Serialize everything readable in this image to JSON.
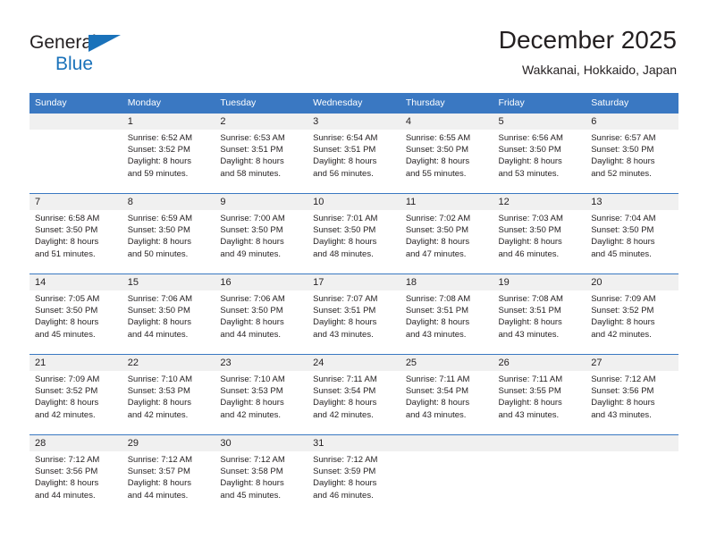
{
  "brand": {
    "name_top": "General",
    "name_bottom": "Blue",
    "triangle_color": "#1a72ba",
    "text_color": "#231f20"
  },
  "header": {
    "title": "December 2025",
    "subtitle": "Wakkanai, Hokkaido, Japan"
  },
  "theme": {
    "header_bg": "#3a78c2",
    "header_text": "#ffffff",
    "daynum_bg": "#f0f0f0",
    "cell_bg": "#ffffff",
    "body_text": "#231f20"
  },
  "calendar": {
    "weekday_headers": [
      "Sunday",
      "Monday",
      "Tuesday",
      "Wednesday",
      "Thursday",
      "Friday",
      "Saturday"
    ],
    "weeks": [
      [
        {
          "day": "",
          "lines": []
        },
        {
          "day": "1",
          "lines": [
            "Sunrise: 6:52 AM",
            "Sunset: 3:52 PM",
            "Daylight: 8 hours",
            "and 59 minutes."
          ]
        },
        {
          "day": "2",
          "lines": [
            "Sunrise: 6:53 AM",
            "Sunset: 3:51 PM",
            "Daylight: 8 hours",
            "and 58 minutes."
          ]
        },
        {
          "day": "3",
          "lines": [
            "Sunrise: 6:54 AM",
            "Sunset: 3:51 PM",
            "Daylight: 8 hours",
            "and 56 minutes."
          ]
        },
        {
          "day": "4",
          "lines": [
            "Sunrise: 6:55 AM",
            "Sunset: 3:50 PM",
            "Daylight: 8 hours",
            "and 55 minutes."
          ]
        },
        {
          "day": "5",
          "lines": [
            "Sunrise: 6:56 AM",
            "Sunset: 3:50 PM",
            "Daylight: 8 hours",
            "and 53 minutes."
          ]
        },
        {
          "day": "6",
          "lines": [
            "Sunrise: 6:57 AM",
            "Sunset: 3:50 PM",
            "Daylight: 8 hours",
            "and 52 minutes."
          ]
        }
      ],
      [
        {
          "day": "7",
          "lines": [
            "Sunrise: 6:58 AM",
            "Sunset: 3:50 PM",
            "Daylight: 8 hours",
            "and 51 minutes."
          ]
        },
        {
          "day": "8",
          "lines": [
            "Sunrise: 6:59 AM",
            "Sunset: 3:50 PM",
            "Daylight: 8 hours",
            "and 50 minutes."
          ]
        },
        {
          "day": "9",
          "lines": [
            "Sunrise: 7:00 AM",
            "Sunset: 3:50 PM",
            "Daylight: 8 hours",
            "and 49 minutes."
          ]
        },
        {
          "day": "10",
          "lines": [
            "Sunrise: 7:01 AM",
            "Sunset: 3:50 PM",
            "Daylight: 8 hours",
            "and 48 minutes."
          ]
        },
        {
          "day": "11",
          "lines": [
            "Sunrise: 7:02 AM",
            "Sunset: 3:50 PM",
            "Daylight: 8 hours",
            "and 47 minutes."
          ]
        },
        {
          "day": "12",
          "lines": [
            "Sunrise: 7:03 AM",
            "Sunset: 3:50 PM",
            "Daylight: 8 hours",
            "and 46 minutes."
          ]
        },
        {
          "day": "13",
          "lines": [
            "Sunrise: 7:04 AM",
            "Sunset: 3:50 PM",
            "Daylight: 8 hours",
            "and 45 minutes."
          ]
        }
      ],
      [
        {
          "day": "14",
          "lines": [
            "Sunrise: 7:05 AM",
            "Sunset: 3:50 PM",
            "Daylight: 8 hours",
            "and 45 minutes."
          ]
        },
        {
          "day": "15",
          "lines": [
            "Sunrise: 7:06 AM",
            "Sunset: 3:50 PM",
            "Daylight: 8 hours",
            "and 44 minutes."
          ]
        },
        {
          "day": "16",
          "lines": [
            "Sunrise: 7:06 AM",
            "Sunset: 3:50 PM",
            "Daylight: 8 hours",
            "and 44 minutes."
          ]
        },
        {
          "day": "17",
          "lines": [
            "Sunrise: 7:07 AM",
            "Sunset: 3:51 PM",
            "Daylight: 8 hours",
            "and 43 minutes."
          ]
        },
        {
          "day": "18",
          "lines": [
            "Sunrise: 7:08 AM",
            "Sunset: 3:51 PM",
            "Daylight: 8 hours",
            "and 43 minutes."
          ]
        },
        {
          "day": "19",
          "lines": [
            "Sunrise: 7:08 AM",
            "Sunset: 3:51 PM",
            "Daylight: 8 hours",
            "and 43 minutes."
          ]
        },
        {
          "day": "20",
          "lines": [
            "Sunrise: 7:09 AM",
            "Sunset: 3:52 PM",
            "Daylight: 8 hours",
            "and 42 minutes."
          ]
        }
      ],
      [
        {
          "day": "21",
          "lines": [
            "Sunrise: 7:09 AM",
            "Sunset: 3:52 PM",
            "Daylight: 8 hours",
            "and 42 minutes."
          ]
        },
        {
          "day": "22",
          "lines": [
            "Sunrise: 7:10 AM",
            "Sunset: 3:53 PM",
            "Daylight: 8 hours",
            "and 42 minutes."
          ]
        },
        {
          "day": "23",
          "lines": [
            "Sunrise: 7:10 AM",
            "Sunset: 3:53 PM",
            "Daylight: 8 hours",
            "and 42 minutes."
          ]
        },
        {
          "day": "24",
          "lines": [
            "Sunrise: 7:11 AM",
            "Sunset: 3:54 PM",
            "Daylight: 8 hours",
            "and 42 minutes."
          ]
        },
        {
          "day": "25",
          "lines": [
            "Sunrise: 7:11 AM",
            "Sunset: 3:54 PM",
            "Daylight: 8 hours",
            "and 43 minutes."
          ]
        },
        {
          "day": "26",
          "lines": [
            "Sunrise: 7:11 AM",
            "Sunset: 3:55 PM",
            "Daylight: 8 hours",
            "and 43 minutes."
          ]
        },
        {
          "day": "27",
          "lines": [
            "Sunrise: 7:12 AM",
            "Sunset: 3:56 PM",
            "Daylight: 8 hours",
            "and 43 minutes."
          ]
        }
      ],
      [
        {
          "day": "28",
          "lines": [
            "Sunrise: 7:12 AM",
            "Sunset: 3:56 PM",
            "Daylight: 8 hours",
            "and 44 minutes."
          ]
        },
        {
          "day": "29",
          "lines": [
            "Sunrise: 7:12 AM",
            "Sunset: 3:57 PM",
            "Daylight: 8 hours",
            "and 44 minutes."
          ]
        },
        {
          "day": "30",
          "lines": [
            "Sunrise: 7:12 AM",
            "Sunset: 3:58 PM",
            "Daylight: 8 hours",
            "and 45 minutes."
          ]
        },
        {
          "day": "31",
          "lines": [
            "Sunrise: 7:12 AM",
            "Sunset: 3:59 PM",
            "Daylight: 8 hours",
            "and 46 minutes."
          ]
        },
        {
          "day": "",
          "lines": []
        },
        {
          "day": "",
          "lines": []
        },
        {
          "day": "",
          "lines": []
        }
      ]
    ]
  }
}
